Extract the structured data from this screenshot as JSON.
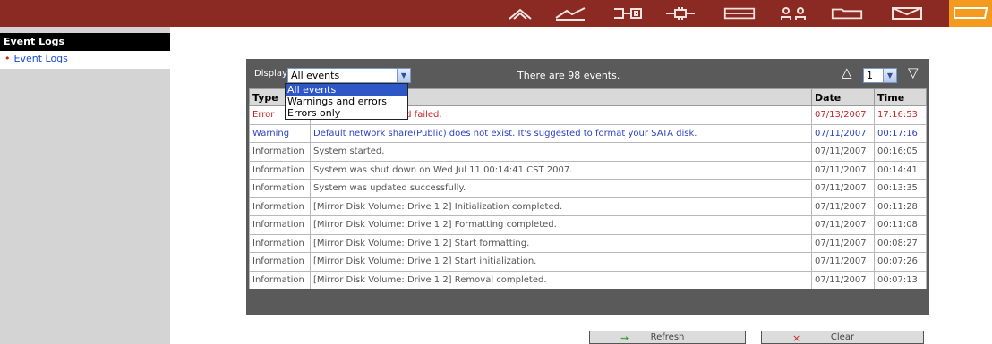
{
  "topbar": {
    "icons": [
      {
        "name": "home-icon"
      },
      {
        "name": "network-icon"
      },
      {
        "name": "storage-icon"
      },
      {
        "name": "connection-icon"
      },
      {
        "name": "drive-icon"
      },
      {
        "name": "users-icon"
      },
      {
        "name": "folder-icon"
      },
      {
        "name": "mail-icon"
      },
      {
        "name": "tag-icon",
        "active": true
      }
    ],
    "bg_color": "#8b2a22",
    "active_color": "#f49b1f"
  },
  "sidebar": {
    "heading": "Event Logs",
    "items": [
      {
        "label": "Event Logs"
      }
    ]
  },
  "panel": {
    "display_label": "Display",
    "display_value": "All events",
    "count_text": "There are 98 events.",
    "page_value": "1",
    "dropdown_options": [
      "All events",
      "Warnings and errors",
      "Errors only"
    ]
  },
  "table": {
    "headers": {
      "type": "Type",
      "message": "",
      "date": "Date",
      "time": "Time"
    },
    "rows": [
      {
        "type": "Error",
        "message": "ed failed.",
        "date": "07/13/2007",
        "time": "17:16:53",
        "level": "error"
      },
      {
        "type": "Warning",
        "message": "Default network share(Public) does not exist. It's suggested to format your SATA disk.",
        "date": "07/11/2007",
        "time": "00:17:16",
        "level": "warning"
      },
      {
        "type": "Information",
        "message": "System started.",
        "date": "07/11/2007",
        "time": "00:16:05",
        "level": "info"
      },
      {
        "type": "Information",
        "message": "System was shut down on Wed Jul 11 00:14:41 CST 2007.",
        "date": "07/11/2007",
        "time": "00:14:41",
        "level": "info"
      },
      {
        "type": "Information",
        "message": "System was updated successfully.",
        "date": "07/11/2007",
        "time": "00:13:35",
        "level": "info"
      },
      {
        "type": "Information",
        "message": "[Mirror Disk Volume: Drive 1 2] Initialization completed.",
        "date": "07/11/2007",
        "time": "00:11:28",
        "level": "info"
      },
      {
        "type": "Information",
        "message": "[Mirror Disk Volume: Drive 1 2] Formatting completed.",
        "date": "07/11/2007",
        "time": "00:11:08",
        "level": "info"
      },
      {
        "type": "Information",
        "message": "[Mirror Disk Volume: Drive 1 2] Start formatting.",
        "date": "07/11/2007",
        "time": "00:08:27",
        "level": "info"
      },
      {
        "type": "Information",
        "message": "[Mirror Disk Volume: Drive 1 2] Start initialization.",
        "date": "07/11/2007",
        "time": "00:07:26",
        "level": "info"
      },
      {
        "type": "Information",
        "message": "[Mirror Disk Volume: Drive 1 2] Removal completed.",
        "date": "07/11/2007",
        "time": "00:07:13",
        "level": "info"
      }
    ]
  },
  "buttons": {
    "refresh_label": "Refresh",
    "clear_label": "Clear"
  }
}
